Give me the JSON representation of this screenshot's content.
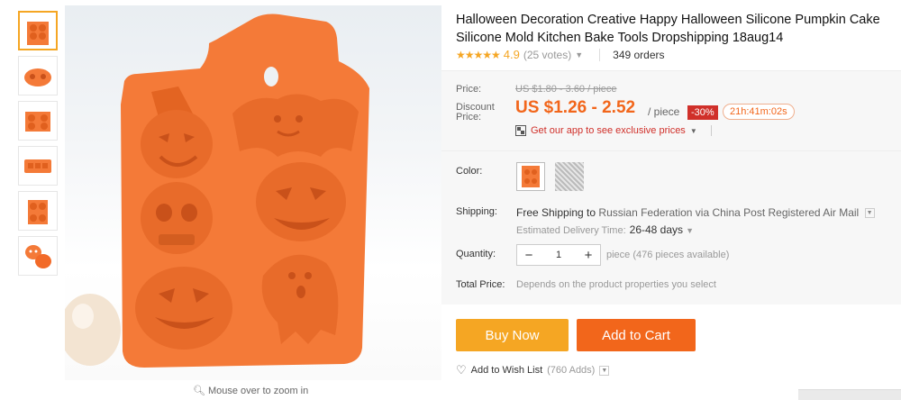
{
  "thumbnails": [
    {
      "alt": "thumbnail-1"
    },
    {
      "alt": "thumbnail-2"
    },
    {
      "alt": "thumbnail-3"
    },
    {
      "alt": "thumbnail-4"
    },
    {
      "alt": "thumbnail-5"
    },
    {
      "alt": "thumbnail-6"
    }
  ],
  "zoom_hint": "Mouse over to zoom in",
  "product": {
    "title": "Halloween Decoration Creative Happy Halloween Silicone Pumpkin Cake Silicone Mold Kitchen Bake Tools Dropshipping 18aug14",
    "stars": "★★★★★",
    "score": "4.9",
    "votes": "(25 votes)",
    "orders": "349 orders"
  },
  "price": {
    "label": "Price:",
    "old": "US $1.80 - 3.60 / piece",
    "discount_label_1": "Discount",
    "discount_label_2": "Price:",
    "new": "US $1.26 - 2.52",
    "per": "/ piece",
    "discount_pct": "-30%",
    "timer": "21h:41m:02s",
    "app_text": "Get our app to see exclusive prices"
  },
  "props": {
    "color_label": "Color:",
    "shipping_label": "Shipping:",
    "shipping_free": "Free Shipping to",
    "shipping_dest": "Russian Federation via China Post Registered Air Mail",
    "eta_label": "Estimated Delivery Time:",
    "eta_value": "26-48 days",
    "quantity_label": "Quantity:",
    "qty_minus": "−",
    "qty_value": "1",
    "qty_plus": "+",
    "qty_note": "piece (476 pieces available)",
    "total_label": "Total Price:",
    "total_note": "Depends on the product properties you select"
  },
  "actions": {
    "buy_now": "Buy Now",
    "add_to_cart": "Add to Cart",
    "wish": "Add to Wish List",
    "wish_count": "(760 Adds)"
  },
  "colors": {
    "orange": "#f2661b",
    "mold": "#f47a38",
    "accent": "#f5a623"
  }
}
